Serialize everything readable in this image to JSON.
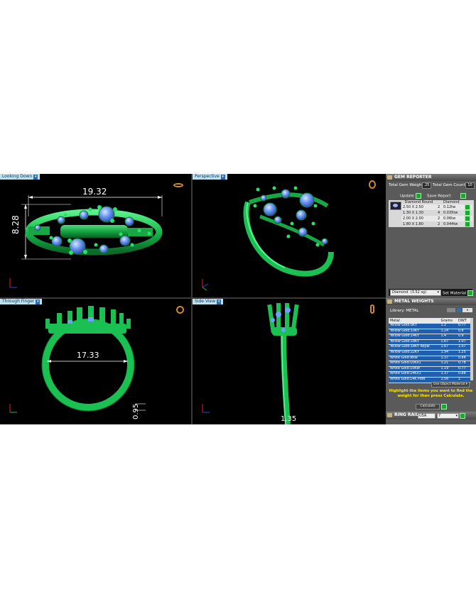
{
  "viewports": {
    "top_left": {
      "label": "Looking Down",
      "dims": {
        "width": "19.32",
        "height": "8.28"
      }
    },
    "top_right": {
      "label": "Perspective"
    },
    "bottom_left": {
      "label": "Through Finger",
      "dims": {
        "inner": "17.33",
        "band": "0.95"
      }
    },
    "bottom_right": {
      "label": "Side View",
      "dims": {
        "width": "1.35"
      }
    }
  },
  "gem_reporter": {
    "title": "GEM REPORTER",
    "total_weight_label": "Total Gem Weight",
    "total_weight_value": ".25",
    "total_count_label": "Total Gem Count",
    "total_count_value": "10",
    "update_label": "Update",
    "save_report_label": "Save Report",
    "table_col1": "Diamond Round",
    "table_col2": "Diamond",
    "rows": [
      {
        "size": "2.50 X 2.50",
        "count": "2",
        "wt": "0.12tw"
      },
      {
        "size": "1.30 X 1.30",
        "count": "4",
        "wt": "0.035tw"
      },
      {
        "size": "2.00 X 2.00",
        "count": "2",
        "wt": "0.06tw"
      },
      {
        "size": "1.80 X 1.80",
        "count": "2",
        "wt": "0.044tw"
      }
    ],
    "material_select": "Diamond",
    "material_sg": "(3.52 sg)",
    "set_material_label": "Set Material"
  },
  "metal_weights": {
    "title": "METAL WEIGHTS",
    "library_label": "Library: METAL",
    "col_metal": "Metal",
    "col_grams": "Grams",
    "col_dwt": "DWT",
    "rows": [
      {
        "metal": "Yellow Gold:9KY",
        "grams": "1.2",
        "dwt": "0.77"
      },
      {
        "metal": "Yellow Gold:10KY",
        "grams": "1.24",
        "dwt": "0.8"
      },
      {
        "metal": "Yellow Gold:14KY",
        "grams": "1.4",
        "dwt": "0.9"
      },
      {
        "metal": "Yellow Gold:18KY",
        "grams": "1.67",
        "dwt": "1.07"
      },
      {
        "metal": "Yellow Gold:18KY Royal",
        "grams": "1.67",
        "dwt": "1.07"
      },
      {
        "metal": "Yellow Gold:22KY",
        "grams": "1.94",
        "dwt": "1.25"
      },
      {
        "metal": "White Gold:9KW",
        "grams": "1.37",
        "dwt": "0.88"
      },
      {
        "metal": "White Gold:10KX1",
        "grams": "1.21",
        "dwt": "0.78"
      },
      {
        "metal": "White Gold:10KW",
        "grams": "1.19",
        "dwt": "0.77"
      },
      {
        "metal": "White Gold:14KX1",
        "grams": "1.37",
        "dwt": "0.88"
      },
      {
        "metal": "White Gold:14K PdW",
        "grams": "1.56",
        "dwt": "1"
      }
    ],
    "use_object_material": "Use Object Material",
    "highlight_text": "Highlight the items you want to find the weight for then press Calculate.",
    "calculate_label": "Calculate"
  },
  "ring_rail": {
    "title": "RING RAIL",
    "region": "USA",
    "size": "7"
  },
  "colors": {
    "ring": "#1fd05a",
    "gem": "#6aa0ff",
    "panel": "#5a5a5a"
  }
}
